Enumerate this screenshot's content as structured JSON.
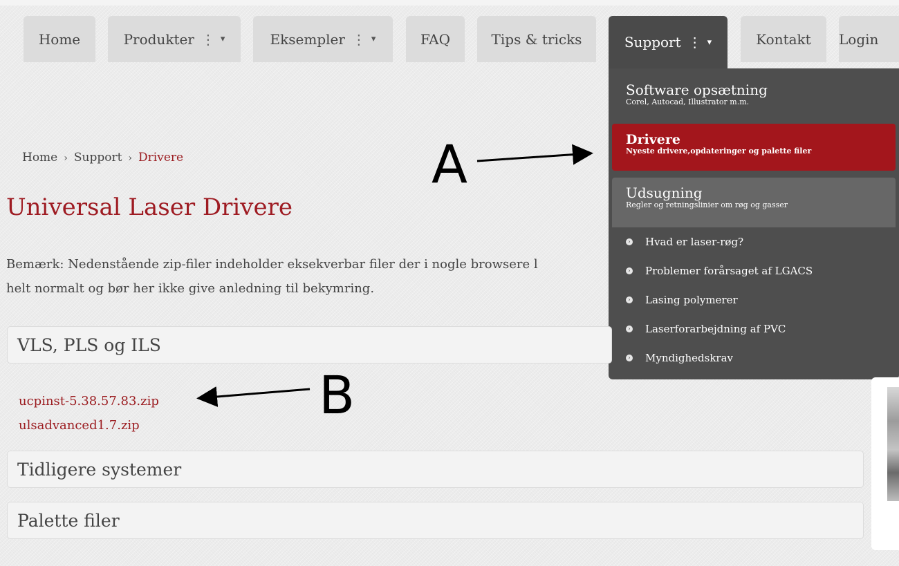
{
  "nav": {
    "items": [
      {
        "label": "Home"
      },
      {
        "label": "Produkter"
      },
      {
        "label": "Eksempler"
      },
      {
        "label": "FAQ"
      },
      {
        "label": "Tips & tricks"
      },
      {
        "label": "Support"
      },
      {
        "label": "Kontakt"
      },
      {
        "label": "Login"
      }
    ],
    "separator": "⋮",
    "caret": "▾"
  },
  "dropdown": {
    "software": {
      "title": "Software opsætning",
      "subtitle": "Corel, Autocad, Illustrator m.m."
    },
    "drivere": {
      "title": "Drivere",
      "subtitle": "Nyeste drivere,opdateringer og palette filer"
    },
    "udsugning": {
      "title": "Udsugning",
      "subtitle": "Regler og retningslinier om røg og gasser"
    },
    "list": [
      "Hvad er laser-røg?",
      "Problemer forårsaget af LGACS",
      "Lasing polymerer",
      "Laserforarbejdning af PVC",
      "Myndighedskrav"
    ]
  },
  "breadcrumb": {
    "home": "Home",
    "support": "Support",
    "current": "Drivere",
    "sep": "›"
  },
  "page_title": "Universal Laser Drivere",
  "note": {
    "line1": "Bemærk: Nedenstående zip-filer indeholder eksekverbar filer der i nogle browsere l",
    "line2": "helt normalt og bør her ikke give anledning til bekymring."
  },
  "sections": {
    "vls": "VLS, PLS og ILS",
    "tidligere": "Tidligere systemer",
    "palette": "Palette filer"
  },
  "downloads": [
    "ucpinst-5.38.57.83.zip",
    "ulsadvanced1.7.zip"
  ],
  "annotations": {
    "a": "A",
    "b": "B"
  },
  "colors": {
    "accent": "#9e1b22",
    "dropdown_bg": "#4e4e4e",
    "active_item": "#a3161c"
  }
}
